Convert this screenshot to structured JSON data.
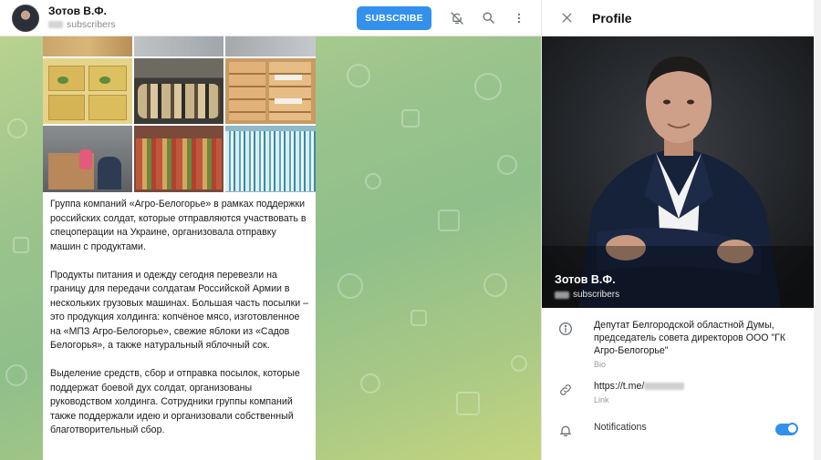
{
  "header": {
    "channel_name": "Зотов В.Ф.",
    "subscribers_label": "subscribers",
    "subscribe_label": "SUBSCRIBE"
  },
  "post": {
    "paragraphs": [
      "Группа компаний «Агро-Белогорье» в рамках поддержки российских солдат, которые отправляются участвовать в спецоперации на Украине, организовала отправку машин с продуктами.",
      "Продукты питания и одежду сегодня перевезли на границу для передачи солдатам Российской Армии в нескольких грузовых машинах. Большая часть посылки – это продукция холдинга: копчёное мясо, изготовленное на «МПЗ Агро-Белогорье», свежие яблоки из «Садов Белогорья», а также натуральный яблочный сок.",
      "Выделение средств, сбор и отправка посылок, которые поддержат боевой дух солдат, организованы руководством холдинга. Сотрудники группы компаний также поддержали идею и организовали собственный благотворительный сбор."
    ]
  },
  "profile": {
    "title": "Profile",
    "photo_name": "Зотов В.Ф.",
    "photo_subscribers_label": "subscribers",
    "bio_text": "Депутат Белгородской областной Думы, председатель совета директоров ООО \"ГК Агро-Белогорье\"",
    "bio_label": "Bio",
    "link_text": "https://t.me/",
    "link_label": "Link",
    "notifications_label": "Notifications",
    "notifications_on": true
  },
  "colors": {
    "accent": "#3390ec",
    "wallpaper": "#9cc48c"
  },
  "icons": [
    "mute-bell-icon",
    "search-icon",
    "more-vertical-icon",
    "close-icon",
    "info-icon",
    "link-icon",
    "bell-icon"
  ]
}
